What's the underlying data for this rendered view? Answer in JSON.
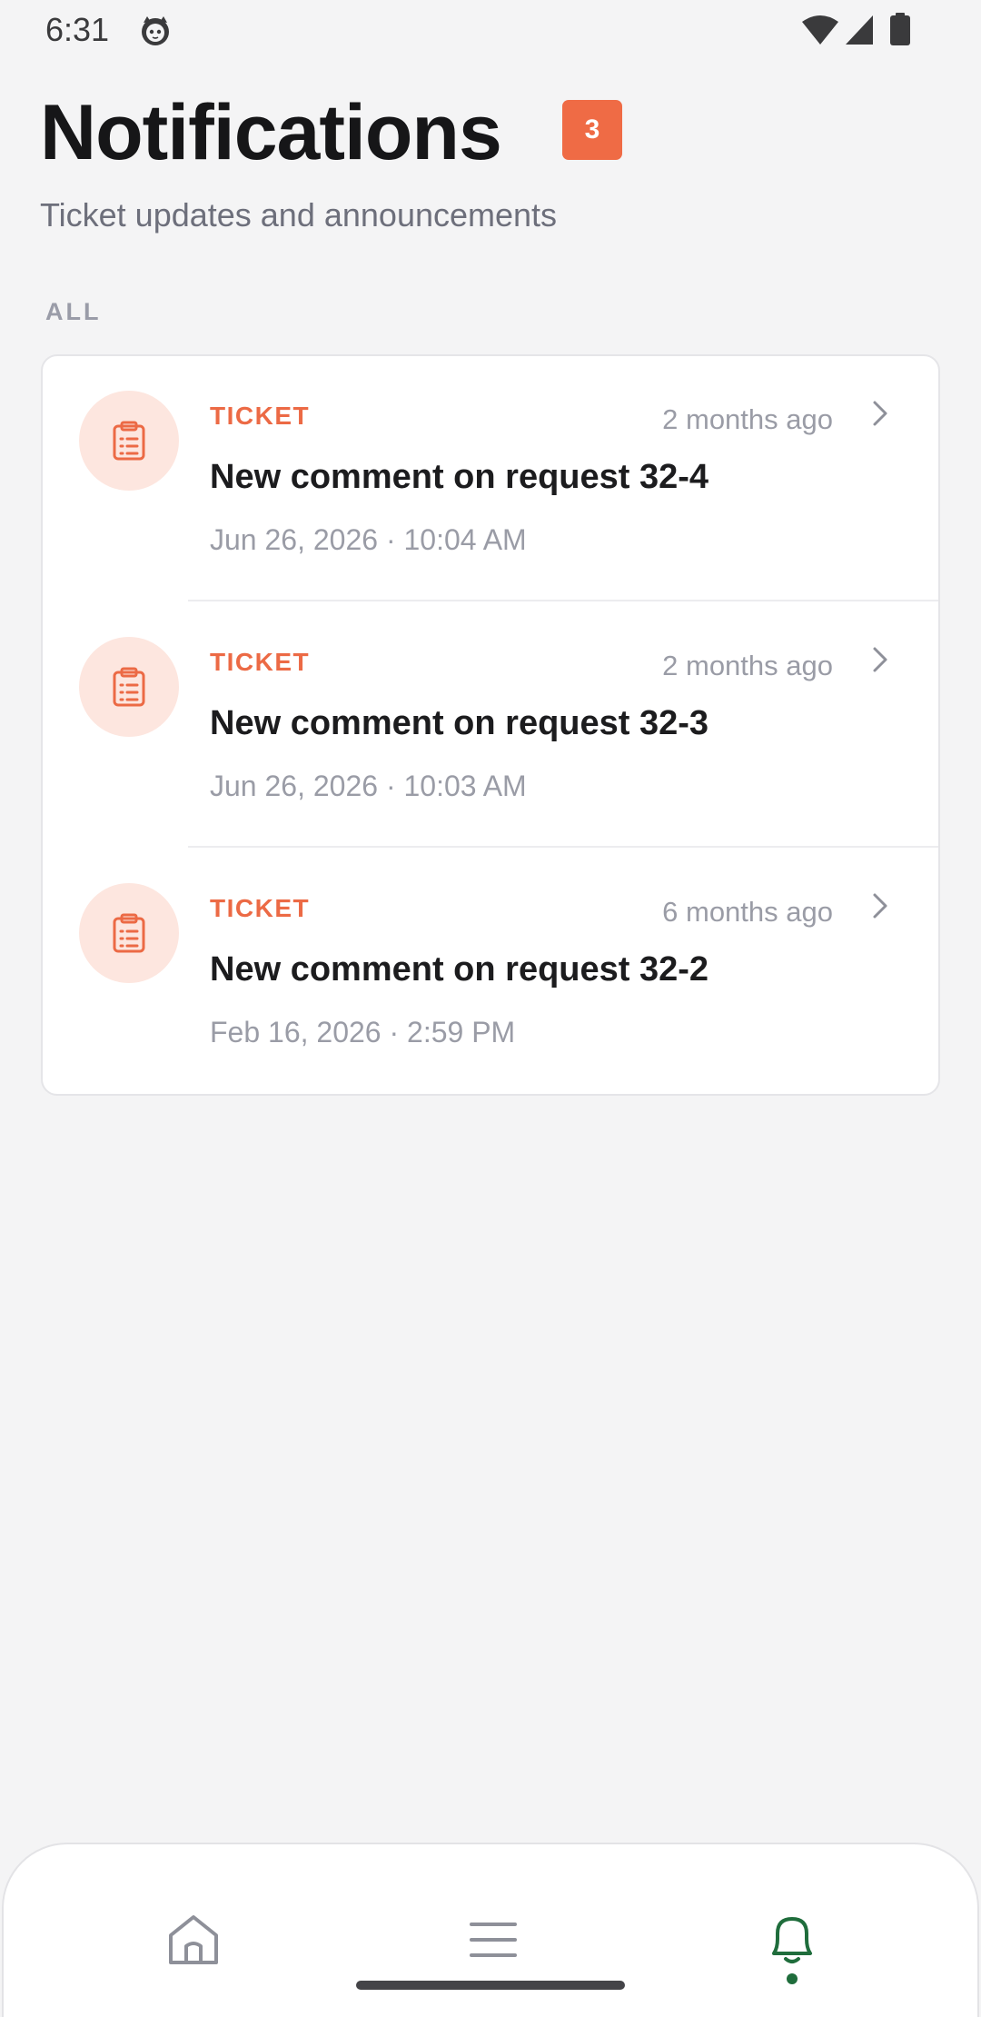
{
  "status_bar": {
    "time": "6:31",
    "icons": [
      "cat-icon",
      "wifi-icon",
      "signal-icon",
      "battery-icon"
    ]
  },
  "header": {
    "title": "Notifications",
    "badge_count": "3",
    "subtitle": "Ticket updates and announcements"
  },
  "section": {
    "label": "ALL"
  },
  "notifications": [
    {
      "type": "TICKET",
      "relative_time": "2 months ago",
      "title": "New comment on request 32-4",
      "date": "Jun 26, 2026 · 10:04 AM",
      "icon": "clipboard-icon"
    },
    {
      "type": "TICKET",
      "relative_time": "2 months ago",
      "title": "New comment on request 32-3",
      "date": "Jun 26, 2026 · 10:03 AM",
      "icon": "clipboard-icon"
    },
    {
      "type": "TICKET",
      "relative_time": "6 months ago",
      "title": "New comment on request 32-2",
      "date": "Feb 16, 2026 · 2:59 PM",
      "icon": "clipboard-icon"
    }
  ],
  "bottom_nav": {
    "items": [
      {
        "icon": "home-icon",
        "active": false
      },
      {
        "icon": "menu-icon",
        "active": false
      },
      {
        "icon": "bell-icon",
        "active": true
      }
    ]
  },
  "colors": {
    "accent": "#ef6b45",
    "accent_soft": "#fde6df",
    "active_nav": "#1f6d3c",
    "background": "#f4f4f5"
  }
}
